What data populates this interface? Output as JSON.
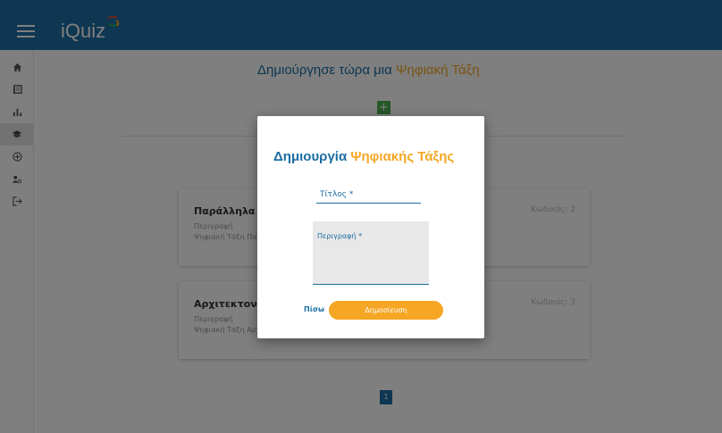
{
  "app": {
    "name": "iQuiz"
  },
  "sidebar": {
    "items": [
      {
        "icon": "home-icon",
        "glyph": "⌂"
      },
      {
        "icon": "library-icon",
        "glyph": "▤"
      },
      {
        "icon": "bar-chart-icon",
        "glyph": "▥"
      },
      {
        "icon": "graduation-cap-icon",
        "glyph": "🎓",
        "active": true
      },
      {
        "icon": "add-circle-icon",
        "glyph": "⊕"
      },
      {
        "icon": "users-icon",
        "glyph": "👥"
      },
      {
        "icon": "logout-icon",
        "glyph": "⇥"
      }
    ]
  },
  "main": {
    "heading_main": "Δημιούργησε τώρα μια",
    "heading_accent": "Ψηφιακή Τάξη",
    "add_button": "+",
    "cards": [
      {
        "title": "Παράλληλα Συ",
        "description_label": "Περιγραφή",
        "description": "Ψηφιακή Τάξη Παρ",
        "code": "Κωδικός: 2"
      },
      {
        "title": "Αρχιτεκτονική",
        "description_label": "Περιγραφή",
        "description": "Ψηφιακή Τάξη Αρχ",
        "code": "Κωδικός: 3"
      }
    ],
    "pagination": {
      "current_page": "1"
    }
  },
  "modal": {
    "title_main": "Δημιουργία",
    "title_accent": "Ψηφιακής Τάξης",
    "title_field_label": "Τίτλος *",
    "description_field_label": "Περιγραφή *",
    "back_button": "Πίσω",
    "publish_button": "Δημοσίευση"
  },
  "colors": {
    "primary": "#1c6ea4",
    "accent": "#f5a623",
    "add_green": "#4caf50"
  }
}
